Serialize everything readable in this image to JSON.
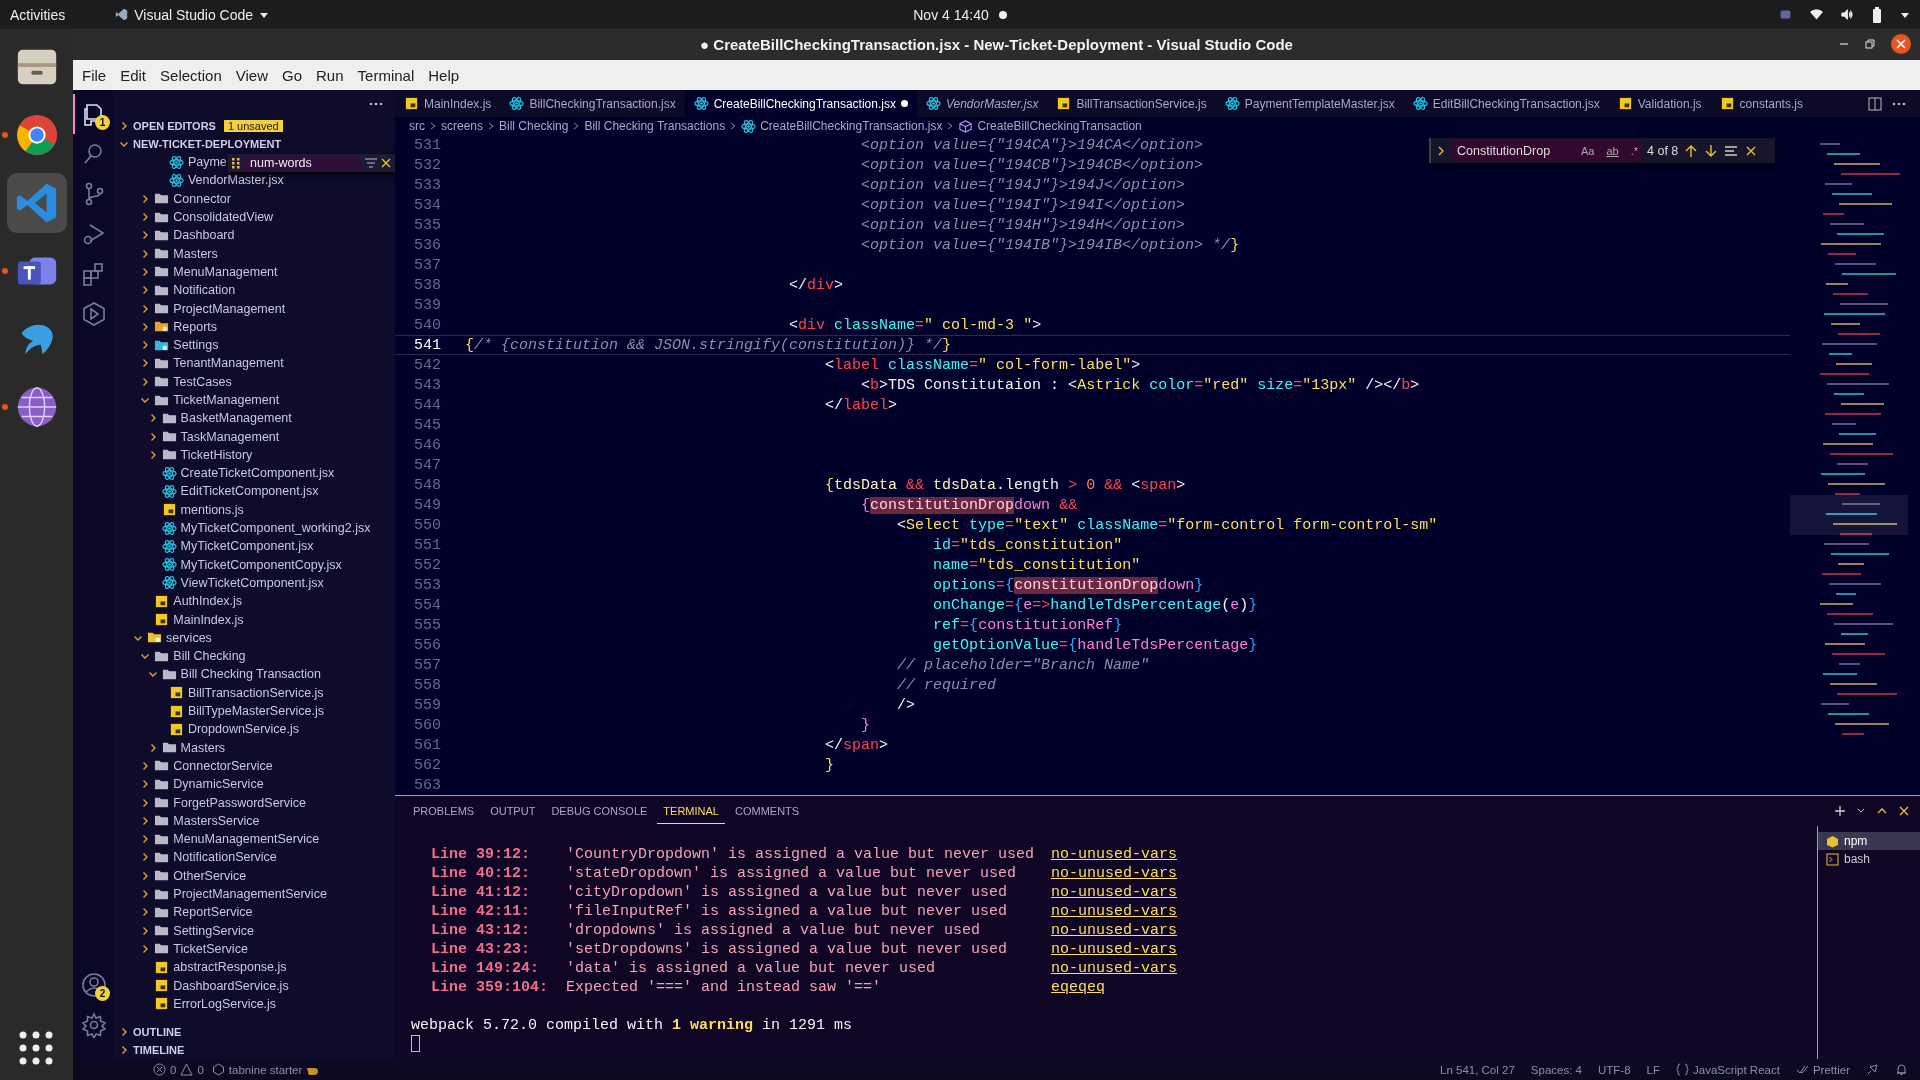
{
  "top_bar": {
    "activities": "Activities",
    "app": "Visual Studio Code",
    "clock": "Nov 4  14:40"
  },
  "dock": [
    {
      "kind": "files",
      "running": false,
      "selected": false
    },
    {
      "kind": "chrome",
      "running": true,
      "selected": false
    },
    {
      "kind": "vscode",
      "running": false,
      "selected": true
    },
    {
      "kind": "teams",
      "running": true,
      "selected": false
    },
    {
      "kind": "dolphin",
      "running": false,
      "selected": false
    },
    {
      "kind": "globe",
      "running": true,
      "selected": false
    }
  ],
  "window": {
    "title": "● CreateBillCheckingTransaction.jsx - New-Ticket-Deployment - Visual Studio Code"
  },
  "menu": [
    "File",
    "Edit",
    "Selection",
    "View",
    "Go",
    "Run",
    "Terminal",
    "Help"
  ],
  "activity_bar": [
    {
      "kind": "explorer",
      "selected": true,
      "badge": "1"
    },
    {
      "kind": "search",
      "selected": false
    },
    {
      "kind": "scm",
      "selected": false
    },
    {
      "kind": "debug",
      "selected": false
    },
    {
      "kind": "extensions",
      "selected": false
    },
    {
      "kind": "remote",
      "selected": false
    }
  ],
  "accounts_badge": "2",
  "sidebar": {
    "open_editors": {
      "label": "OPEN EDITORS",
      "badge": "1 unsaved",
      "expanded": false
    },
    "project": {
      "label": "NEW-TICKET-DEPLOYMENT",
      "expanded": true
    },
    "tree_filter": {
      "value": "num-words"
    },
    "tree": [
      {
        "children": [
          {
            "children": [
              {
                "children": [
                  {
                    "label": "Payme",
                    "kind": "react"
                  },
                  {
                    "label": "VendorMaster.jsx",
                    "kind": "react"
                  }
                ]
              }
            ]
          },
          {
            "label": "Connector",
            "kind": "folder",
            "expanded": false
          },
          {
            "label": "ConsolidatedView",
            "kind": "folder",
            "expanded": false
          },
          {
            "label": "Dashboard",
            "kind": "folder",
            "expanded": false
          },
          {
            "label": "Masters",
            "kind": "folder",
            "expanded": false
          },
          {
            "label": "MenuManagement",
            "kind": "folder",
            "expanded": false
          },
          {
            "label": "Notification",
            "kind": "folder",
            "expanded": false
          },
          {
            "label": "ProjectManagement",
            "kind": "folder",
            "expanded": false
          },
          {
            "label": "Reports",
            "kind": "reports",
            "expanded": false
          },
          {
            "label": "Settings",
            "kind": "settings",
            "expanded": false
          },
          {
            "label": "TenantManagement",
            "kind": "folder",
            "expanded": false
          },
          {
            "label": "TestCases",
            "kind": "folder",
            "expanded": false
          },
          {
            "label": "TicketManagement",
            "kind": "folder",
            "expanded": true,
            "children": [
              {
                "label": "BasketManagement",
                "kind": "folder",
                "expanded": false
              },
              {
                "label": "TaskManagement",
                "kind": "folder",
                "expanded": false
              },
              {
                "label": "TicketHistory",
                "kind": "folder",
                "expanded": false
              },
              {
                "label": "CreateTicketComponent.jsx",
                "kind": "react"
              },
              {
                "label": "EditTicketComponent.jsx",
                "kind": "react"
              },
              {
                "label": "mentions.js",
                "kind": "js"
              },
              {
                "label": "MyTicketComponent_working2.jsx",
                "kind": "react"
              },
              {
                "label": "MyTicketComponent.jsx",
                "kind": "react"
              },
              {
                "label": "MyTicketComponentCopy.jsx",
                "kind": "react"
              },
              {
                "label": "ViewTicketComponent.jsx",
                "kind": "react"
              }
            ]
          },
          {
            "label": "AuthIndex.js",
            "kind": "js"
          },
          {
            "label": "MainIndex.js",
            "kind": "js"
          }
        ]
      },
      {
        "label": "services",
        "kind": "services",
        "expanded": true,
        "children": [
          {
            "label": "Bill Checking",
            "kind": "folder",
            "expanded": true,
            "children": [
              {
                "label": "Bill Checking Transaction",
                "kind": "folder",
                "expanded": true,
                "children": [
                  {
                    "label": "BillTransactionService.js",
                    "kind": "js"
                  },
                  {
                    "label": "BillTypeMasterService.js",
                    "kind": "js"
                  },
                  {
                    "label": "DropdownService.js",
                    "kind": "js"
                  }
                ]
              },
              {
                "label": "Masters",
                "kind": "folder",
                "expanded": false
              }
            ]
          },
          {
            "label": "ConnectorService",
            "kind": "folder",
            "expanded": false
          },
          {
            "label": "DynamicService",
            "kind": "folder",
            "expanded": false
          },
          {
            "label": "ForgetPasswordService",
            "kind": "folder",
            "expanded": false
          },
          {
            "label": "MastersService",
            "kind": "folder",
            "expanded": false
          },
          {
            "label": "MenuManagementService",
            "kind": "folder",
            "expanded": false
          },
          {
            "label": "NotificationService",
            "kind": "folder",
            "expanded": false
          },
          {
            "label": "OtherService",
            "kind": "folder",
            "expanded": false
          },
          {
            "label": "ProjectManagementService",
            "kind": "folder",
            "expanded": false
          },
          {
            "label": "ReportService",
            "kind": "folder",
            "expanded": false
          },
          {
            "label": "SettingService",
            "kind": "folder",
            "expanded": false
          },
          {
            "label": "TicketService",
            "kind": "folder",
            "expanded": false
          },
          {
            "label": "abstractResponse.js",
            "kind": "js"
          },
          {
            "label": "DashboardService.js",
            "kind": "js"
          },
          {
            "label": "ErrorLogService.js",
            "kind": "js"
          }
        ]
      }
    ],
    "sections": [
      {
        "label": "OUTLINE",
        "expanded": false
      },
      {
        "label": "TIMELINE",
        "expanded": false
      }
    ]
  },
  "tabs": [
    {
      "label": "MainIndex.js",
      "kind": "js",
      "selected": false,
      "modified": false,
      "preview": false
    },
    {
      "label": "BillCheckingTransaction.jsx",
      "kind": "react",
      "selected": false,
      "modified": false,
      "preview": false
    },
    {
      "label": "CreateBillCheckingTransaction.jsx",
      "kind": "react",
      "selected": true,
      "modified": true,
      "preview": false
    },
    {
      "label": "VendorMaster.jsx",
      "kind": "react",
      "selected": false,
      "modified": false,
      "preview": true
    },
    {
      "label": "BillTransactionService.js",
      "kind": "js",
      "selected": false,
      "modified": false,
      "preview": false
    },
    {
      "label": "PaymentTemplateMaster.jsx",
      "kind": "react",
      "selected": false,
      "modified": false,
      "preview": false
    },
    {
      "label": "EditBillCheckingTransaction.jsx",
      "kind": "react",
      "selected": false,
      "modified": false,
      "preview": false
    },
    {
      "label": "Validation.js",
      "kind": "js",
      "selected": false,
      "modified": false,
      "preview": false
    },
    {
      "label": "constants.js",
      "kind": "js",
      "selected": false,
      "modified": false,
      "preview": false
    }
  ],
  "breadcrumbs": [
    {
      "label": "src",
      "kind": "folder"
    },
    {
      "label": "screens",
      "kind": "folder"
    },
    {
      "label": "Bill Checking",
      "kind": "folder"
    },
    {
      "label": "Bill Checking Transactions",
      "kind": "folder"
    },
    {
      "label": "CreateBillCheckingTransaction.jsx",
      "kind": "react"
    },
    {
      "label": "CreateBillCheckingTransaction",
      "kind": "symbol"
    }
  ],
  "find": {
    "value": "ConstitutionDrop",
    "options": [
      {
        "label": "Aa",
        "on": false
      },
      {
        "label": "ab",
        "on": false
      },
      {
        "label": ".*",
        "on": false
      }
    ],
    "count": "4 of 8"
  },
  "code": {
    "lines": [
      {
        "number": "531",
        "current": false,
        "tokens": [
          {
            "t": "                                            <option value={\"194CA\"}>194CA</option>",
            "kind": "comment"
          }
        ]
      },
      {
        "number": "532",
        "current": false,
        "tokens": [
          {
            "t": "                                            <option value={\"194CB\"}>194CB</option>",
            "kind": "comment"
          }
        ]
      },
      {
        "number": "533",
        "current": false,
        "tokens": [
          {
            "t": "                                            <option value={\"194J\"}>194J</option>",
            "kind": "comment"
          }
        ]
      },
      {
        "number": "534",
        "current": false,
        "tokens": [
          {
            "t": "                                            <option value={\"194I\"}>194I</option>",
            "kind": "comment"
          }
        ]
      },
      {
        "number": "535",
        "current": false,
        "tokens": [
          {
            "t": "                                            <option value={\"194H\"}>194H</option>",
            "kind": "comment"
          }
        ]
      },
      {
        "number": "536",
        "current": false,
        "tokens": [
          {
            "t": "                                            <option value={\"194IB\"}>194IB</option> */",
            "kind": "comment"
          },
          {
            "t": "}",
            "kind": "brace"
          }
        ]
      },
      {
        "number": "537",
        "current": false
      },
      {
        "number": "538",
        "current": false,
        "tokens": [
          {
            "t": "                                    </",
            "kind": "text"
          },
          {
            "t": "div",
            "kind": "tag"
          },
          {
            "t": ">",
            "kind": "text"
          }
        ]
      },
      {
        "number": "539",
        "current": false
      },
      {
        "number": "540",
        "current": false,
        "tokens": [
          {
            "t": "                                    <",
            "kind": "text"
          },
          {
            "t": "div",
            "kind": "tag"
          },
          {
            "t": " className",
            "kind": "attr"
          },
          {
            "t": "=",
            "kind": "op"
          },
          {
            "t": "\" col-md-3 \"",
            "kind": "str"
          },
          {
            "t": ">",
            "kind": "text"
          }
        ]
      },
      {
        "number": "541",
        "current": true,
        "tokens": [
          {
            "t": "{",
            "kind": "brace"
          },
          {
            "t": "/* {constitution && JSON.stringify(constitution)} */",
            "kind": "comment"
          },
          {
            "t": "}",
            "kind": "brace"
          }
        ]
      },
      {
        "number": "542",
        "current": false,
        "tokens": [
          {
            "t": "                                        <",
            "kind": "text"
          },
          {
            "t": "label",
            "kind": "tag"
          },
          {
            "t": " className",
            "kind": "attr"
          },
          {
            "t": "=",
            "kind": "op"
          },
          {
            "t": "\" col-form-label\"",
            "kind": "str"
          },
          {
            "t": ">",
            "kind": "text"
          }
        ]
      },
      {
        "number": "543",
        "current": false,
        "tokens": [
          {
            "t": "                                            <",
            "kind": "text"
          },
          {
            "t": "b",
            "kind": "tag"
          },
          {
            "t": ">TDS Constitutaion : <",
            "kind": "text"
          },
          {
            "t": "Astrick",
            "kind": "comp"
          },
          {
            "t": " color",
            "kind": "attr"
          },
          {
            "t": "=",
            "kind": "op"
          },
          {
            "t": "\"red\"",
            "kind": "str"
          },
          {
            "t": " size",
            "kind": "attr"
          },
          {
            "t": "=",
            "kind": "op"
          },
          {
            "t": "\"13px\"",
            "kind": "str"
          },
          {
            "t": " /></",
            "kind": "text"
          },
          {
            "t": "b",
            "kind": "tag"
          },
          {
            "t": ">",
            "kind": "text"
          }
        ]
      },
      {
        "number": "544",
        "current": false,
        "tokens": [
          {
            "t": "                                        </",
            "kind": "text"
          },
          {
            "t": "label",
            "kind": "tag"
          },
          {
            "t": ">",
            "kind": "text"
          }
        ]
      },
      {
        "number": "545",
        "current": false
      },
      {
        "number": "546",
        "current": false
      },
      {
        "number": "547",
        "current": false
      },
      {
        "number": "548",
        "current": false,
        "tokens": [
          {
            "t": "                                        {",
            "kind": "brace"
          },
          {
            "t": "tdsData",
            "kind": "ident"
          },
          {
            "t": " && ",
            "kind": "op"
          },
          {
            "t": "tdsData",
            "kind": "ident"
          },
          {
            "t": ".length",
            "kind": "text"
          },
          {
            "t": " > ",
            "kind": "op"
          },
          {
            "t": "0",
            "kind": "num"
          },
          {
            "t": " && ",
            "kind": "op"
          },
          {
            "t": "<",
            "kind": "text"
          },
          {
            "t": "span",
            "kind": "tag"
          },
          {
            "t": ">",
            "kind": "text"
          }
        ]
      },
      {
        "number": "549",
        "current": false,
        "tokens": [
          {
            "t": "                                            {",
            "kind": "brace3"
          },
          {
            "t": "constitutionDrop",
            "kind": "match"
          },
          {
            "t": "down",
            "kind": "var"
          },
          {
            "t": " &&",
            "kind": "op"
          }
        ]
      },
      {
        "number": "550",
        "current": false,
        "tokens": [
          {
            "t": "                                                <",
            "kind": "text"
          },
          {
            "t": "Select",
            "kind": "comp"
          },
          {
            "t": " type",
            "kind": "attr"
          },
          {
            "t": "=",
            "kind": "op"
          },
          {
            "t": "\"text\"",
            "kind": "str"
          },
          {
            "t": " className",
            "kind": "attr"
          },
          {
            "t": "=",
            "kind": "op"
          },
          {
            "t": "\"form-control form-control-sm\"",
            "kind": "str"
          }
        ]
      },
      {
        "number": "551",
        "current": false,
        "tokens": [
          {
            "t": "                                                    id",
            "kind": "attr"
          },
          {
            "t": "=",
            "kind": "op"
          },
          {
            "t": "\"tds_constitution\"",
            "kind": "str"
          }
        ]
      },
      {
        "number": "552",
        "current": false,
        "tokens": [
          {
            "t": "                                                    name",
            "kind": "attr"
          },
          {
            "t": "=",
            "kind": "op"
          },
          {
            "t": "\"tds_constitution\"",
            "kind": "str"
          }
        ]
      },
      {
        "number": "553",
        "current": false,
        "tokens": [
          {
            "t": "                                                    options",
            "kind": "attr"
          },
          {
            "t": "=",
            "kind": "op"
          },
          {
            "t": "{",
            "kind": "brace2"
          },
          {
            "t": "constitutionDrop",
            "kind": "match"
          },
          {
            "t": "down",
            "kind": "var"
          },
          {
            "t": "}",
            "kind": "brace2"
          }
        ]
      },
      {
        "number": "554",
        "current": false,
        "tokens": [
          {
            "t": "                                                    onChange",
            "kind": "attr"
          },
          {
            "t": "=",
            "kind": "op"
          },
          {
            "t": "{",
            "kind": "brace2"
          },
          {
            "t": "e",
            "kind": "var"
          },
          {
            "t": "=>",
            "kind": "op"
          },
          {
            "t": "handleTdsPercentage",
            "kind": "fn"
          },
          {
            "t": "(",
            "kind": "text"
          },
          {
            "t": "e",
            "kind": "var"
          },
          {
            "t": ")",
            "kind": "text"
          },
          {
            "t": "}",
            "kind": "brace2"
          }
        ]
      },
      {
        "number": "555",
        "current": false,
        "tokens": [
          {
            "t": "                                                    ref",
            "kind": "attr"
          },
          {
            "t": "=",
            "kind": "op"
          },
          {
            "t": "{",
            "kind": "brace2"
          },
          {
            "t": "constitutionRef",
            "kind": "var"
          },
          {
            "t": "}",
            "kind": "brace2"
          }
        ]
      },
      {
        "number": "556",
        "current": false,
        "tokens": [
          {
            "t": "                                                    getOptionValue",
            "kind": "attr"
          },
          {
            "t": "=",
            "kind": "op"
          },
          {
            "t": "{",
            "kind": "brace2"
          },
          {
            "t": "handleTdsPercentage",
            "kind": "var"
          },
          {
            "t": "}",
            "kind": "brace2"
          }
        ]
      },
      {
        "number": "557",
        "current": false,
        "tokens": [
          {
            "t": "                                                // placeholder=\"Branch Name\"",
            "kind": "comment"
          }
        ]
      },
      {
        "number": "558",
        "current": false,
        "tokens": [
          {
            "t": "                                                // required",
            "kind": "comment"
          }
        ]
      },
      {
        "number": "559",
        "current": false,
        "tokens": [
          {
            "t": "                                                />",
            "kind": "text"
          }
        ]
      },
      {
        "number": "560",
        "current": false,
        "tokens": [
          {
            "t": "                                            }",
            "kind": "brace3"
          }
        ]
      },
      {
        "number": "561",
        "current": false,
        "tokens": [
          {
            "t": "                                        </",
            "kind": "text"
          },
          {
            "t": "span",
            "kind": "tag"
          },
          {
            "t": ">",
            "kind": "text"
          }
        ]
      },
      {
        "number": "562",
        "current": false,
        "tokens": [
          {
            "t": "                                        }",
            "kind": "brace"
          }
        ]
      },
      {
        "number": "563",
        "current": false
      }
    ]
  },
  "panel": {
    "tabs": [
      {
        "label": "PROBLEMS",
        "selected": false
      },
      {
        "label": "OUTPUT",
        "selected": false
      },
      {
        "label": "DEBUG CONSOLE",
        "selected": false
      },
      {
        "label": "TERMINAL",
        "selected": true
      },
      {
        "label": "COMMENTS",
        "selected": false
      }
    ],
    "terminal": {
      "rows": [
        {
          "location": "Line 39:12:",
          "message": "'CountryDropdown' is assigned a value but never used",
          "rule": "no-unused-vars"
        },
        {
          "location": "Line 40:12:",
          "message": "'stateDropdown' is assigned a value but never used",
          "rule": "no-unused-vars"
        },
        {
          "location": "Line 41:12:",
          "message": "'cityDropdown' is assigned a value but never used",
          "rule": "no-unused-vars"
        },
        {
          "location": "Line 42:11:",
          "message": "'fileInputRef' is assigned a value but never used",
          "rule": "no-unused-vars"
        },
        {
          "location": "Line 43:12:",
          "message": "'dropdowns' is assigned a value but never used",
          "rule": "no-unused-vars"
        },
        {
          "location": "Line 43:23:",
          "message": "'setDropdowns' is assigned a value but never used",
          "rule": "no-unused-vars"
        },
        {
          "location": "Line 149:24:",
          "message": "'data' is assigned a value but never used",
          "rule": "no-unused-vars"
        },
        {
          "location": "Line 359:104:",
          "message": "Expected '===' and instead saw '=='",
          "rule": "eqeqeq"
        }
      ],
      "summary": "webpack 5.72.0 compiled with **1 warning** in 1291 ms"
    },
    "terminals": [
      {
        "label": "npm",
        "kind": "npm",
        "selected": true
      },
      {
        "label": "bash",
        "kind": "bash",
        "selected": false
      }
    ]
  },
  "status_bar": {
    "errors": "0",
    "warnings": "0",
    "tabnine": "tabnine starter",
    "items": [
      "Ln 541, Col 27",
      "Spaces: 4",
      "UTF-8",
      "LF"
    ],
    "language": "JavaScript React",
    "formatter": "Prettier"
  }
}
